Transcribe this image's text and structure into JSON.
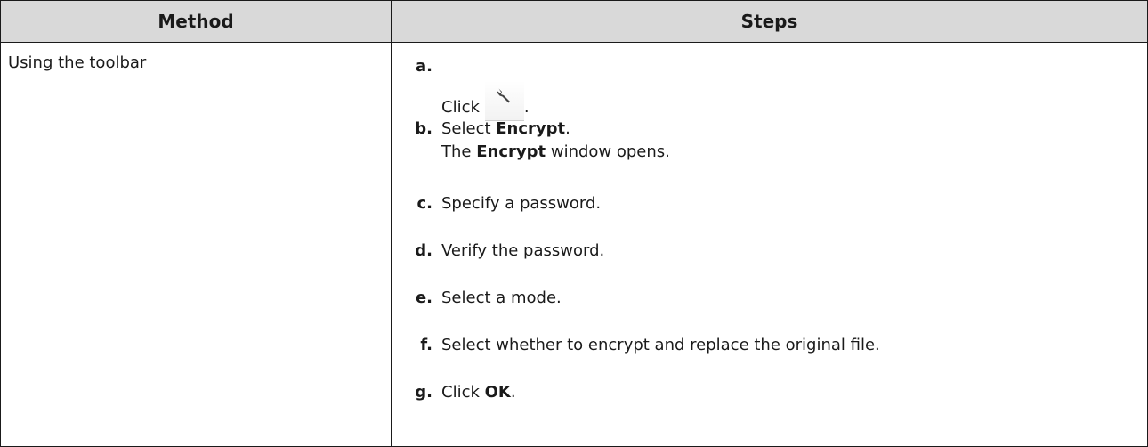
{
  "table": {
    "headers": {
      "method": "Method",
      "steps": "Steps"
    },
    "method": "Using the toolbar",
    "steps": {
      "a": {
        "letter": "a.",
        "pre": "Click",
        "icon": "wrench-icon",
        "post": "."
      },
      "b": {
        "letter": "b.",
        "line1_pre": "Select",
        "line1_bold": "Encrypt",
        "line1_post": ".",
        "line2_pre": "The",
        "line2_bold": "Encrypt",
        "line2_post": "window opens."
      },
      "c": {
        "letter": "c.",
        "text": "Specify a password."
      },
      "d": {
        "letter": "d.",
        "text": "Verify the password."
      },
      "e": {
        "letter": "e.",
        "text": "Select a mode."
      },
      "f": {
        "letter": "f.",
        "text": "Select whether to encrypt and replace the original file."
      },
      "g": {
        "letter": "g.",
        "pre": "Click",
        "bold": "OK",
        "post": "."
      }
    }
  },
  "colors": {
    "header_bg": "#d9d9d9",
    "border": "#1a1a1a",
    "text": "#1a1a1a"
  }
}
